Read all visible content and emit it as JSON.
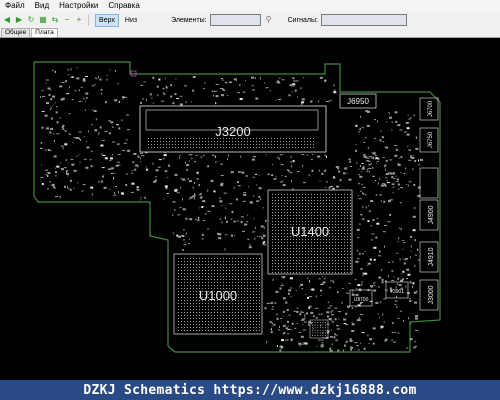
{
  "menu": {
    "items": [
      {
        "label": "Файл"
      },
      {
        "label": "Вид"
      },
      {
        "label": "Настройки"
      },
      {
        "label": "Справка"
      }
    ]
  },
  "toolbar": {
    "side_top_label": "Верх",
    "side_bottom_label": "Низ",
    "elements_label": "Элементы:",
    "elements_value": "",
    "signals_label": "Сигналы:",
    "signals_value": ""
  },
  "tabs": [
    {
      "label": "Общее"
    },
    {
      "label": "Плата"
    }
  ],
  "board": {
    "labels": {
      "j3200": "J3200",
      "u1400": "U1400",
      "u1000": "U1000",
      "j6950": "J6950",
      "j6700": "J6700",
      "j6750": "J6750",
      "j4900": "J4900",
      "j4910": "J4910",
      "j3000": "J3000",
      "u3700": "U3700",
      "small_chip": "T3901"
    },
    "colors": {
      "outline": "#3f8a3f",
      "silk": "#e8e8e8",
      "pad": "#9a9a9a",
      "background": "#000000"
    }
  },
  "footer": {
    "watermark": "DZKJ Schematics https://www.dzkj16888.com"
  }
}
